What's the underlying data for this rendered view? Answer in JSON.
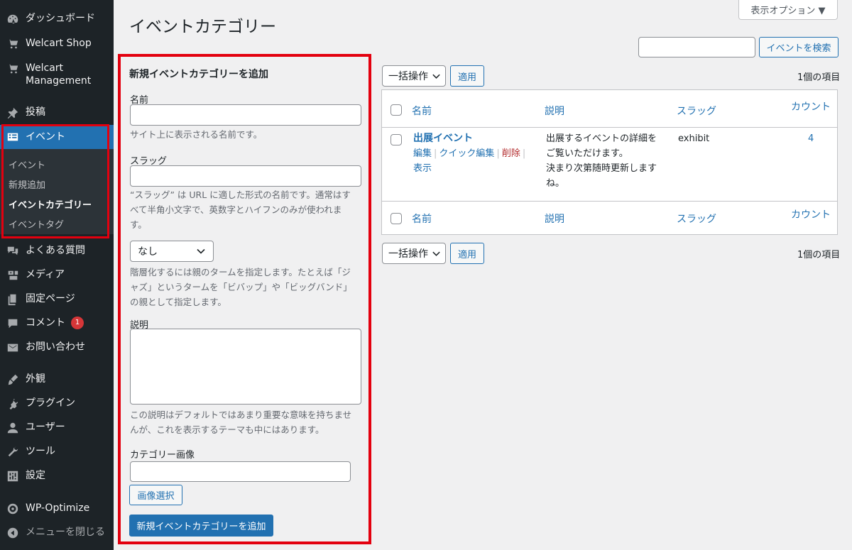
{
  "sidebar": {
    "items": [
      {
        "id": "dashboard",
        "label": "ダッシュボード",
        "icon": "dashboard-icon"
      },
      {
        "id": "welcart-shop",
        "label": "Welcart Shop",
        "icon": "cart-icon"
      },
      {
        "id": "welcart-management",
        "label": "Welcart Management",
        "label_line1": "Welcart",
        "label_line2": "Management",
        "icon": "cart-icon"
      },
      {
        "id": "posts",
        "label": "投稿",
        "icon": "pin-icon"
      },
      {
        "id": "event",
        "label": "イベント",
        "icon": "list-icon"
      },
      {
        "id": "faq",
        "label": "よくある質問",
        "icon": "comments-icon"
      },
      {
        "id": "media",
        "label": "メディア",
        "icon": "media-icon"
      },
      {
        "id": "pages",
        "label": "固定ページ",
        "icon": "page-icon"
      },
      {
        "id": "comments",
        "label": "コメント",
        "icon": "comment-icon",
        "badge": "1"
      },
      {
        "id": "contact",
        "label": "お問い合わせ",
        "icon": "mail-icon"
      },
      {
        "id": "appearance",
        "label": "外観",
        "icon": "brush-icon"
      },
      {
        "id": "plugins",
        "label": "プラグイン",
        "icon": "plugin-icon"
      },
      {
        "id": "users",
        "label": "ユーザー",
        "icon": "user-icon"
      },
      {
        "id": "tools",
        "label": "ツール",
        "icon": "wrench-icon"
      },
      {
        "id": "settings",
        "label": "設定",
        "icon": "settings-icon"
      },
      {
        "id": "wp-optimize",
        "label": "WP-Optimize",
        "icon": "optimize-icon"
      },
      {
        "id": "collapse",
        "label": "メニューを閉じる",
        "icon": "collapse-icon"
      }
    ],
    "submenu": [
      "イベント",
      "新規追加",
      "イベントカテゴリー",
      "イベントタグ"
    ]
  },
  "header": {
    "title": "イベントカテゴリー",
    "screen_options": "表示オプション ▼",
    "search_button": "イベントを検索",
    "search_value": ""
  },
  "form": {
    "heading": "新規イベントカテゴリーを追加",
    "name_label": "名前",
    "name_help": "サイト上に表示される名前です。",
    "slug_label": "スラッグ",
    "slug_help_1": "“スラッグ” は URL に適した形式の名前です。通常はす",
    "slug_help_2": "べて半角小文字で、英数字とハイフンのみが使われま",
    "slug_help_3": "す。",
    "parent_value": "なし",
    "parent_help_1": "階層化するには親のタームを指定します。たとえば「ジ",
    "parent_help_2": "ャズ」というタームを「ビバップ」や「ビッグバンド」",
    "parent_help_3": "の親として指定します。",
    "description_label": "説明",
    "description_help_1": "この説明はデフォルトではあまり重要な意味を持ちませ",
    "description_help_2": "んが、これを表示するテーマも中にはあります。",
    "image_label": "カテゴリー画像",
    "image_select_button": "画像選択",
    "submit_button": "新規イベントカテゴリーを追加"
  },
  "table": {
    "bulk_action": "一括操作",
    "apply": "適用",
    "items_count": "1個の項目",
    "columns": {
      "name": "名前",
      "description": "説明",
      "slug": "スラッグ",
      "count": "カウント"
    },
    "rows": [
      {
        "name": "出展イベント",
        "actions": {
          "edit": "編集",
          "quick_edit": "クイック編集",
          "delete": "削除",
          "view": "表示"
        },
        "description_lines": [
          "出展するイベントの詳細を",
          "ご覧いただけます。",
          "決まり次第随時更新します",
          "ね。"
        ],
        "slug": "exhibit",
        "count": "4"
      }
    ]
  },
  "colors": {
    "accent": "#2271b1",
    "sidebar_bg": "#1d2327",
    "highlight": "#e3000f",
    "danger": "#b32d2e"
  }
}
